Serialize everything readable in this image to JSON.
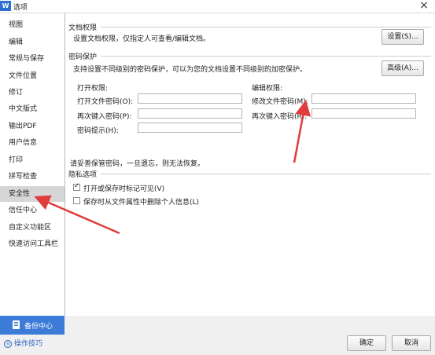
{
  "window": {
    "app_icon": "W",
    "title": "选项",
    "close": "×"
  },
  "sidebar": {
    "items": [
      {
        "label": "视图"
      },
      {
        "label": "编辑"
      },
      {
        "label": "常规与保存"
      },
      {
        "label": "文件位置"
      },
      {
        "label": "修订"
      },
      {
        "label": "中文版式"
      },
      {
        "label": "输出PDF"
      },
      {
        "label": "用户信息"
      },
      {
        "label": "打印"
      },
      {
        "label": "拼写检查"
      },
      {
        "label": "安全性"
      },
      {
        "label": "信任中心"
      },
      {
        "label": "自定义功能区"
      },
      {
        "label": "快速访问工具栏"
      }
    ],
    "active_item": "安全性",
    "backup_label": "备份中心",
    "tips_label": "操作技巧"
  },
  "doc_permission": {
    "title": "文档权限",
    "description": "设置文档权限，仅指定人可查看/编辑文档。",
    "settings_button": "设置(S)..."
  },
  "password": {
    "title": "密码保护",
    "description": "支持设置不同级别的密码保护，可以为您的文档设置不同级别的加密保护。",
    "advanced_button": "高级(A)...",
    "open_perm_title": "打开权限:",
    "open_password_label": "打开文件密码(O):",
    "open_confirm_label": "再次键入密码(P):",
    "hint_label": "密码提示(H):",
    "edit_perm_title": "编辑权限:",
    "modify_password_label": "修改文件密码(M):",
    "modify_confirm_label": "再次键入密码(R):",
    "open_password_value": "",
    "open_confirm_value": "",
    "hint_value": "",
    "modify_password_value": "",
    "modify_confirm_value": "",
    "notice": "请妥善保管密码，一旦遗忘，则无法恢复。"
  },
  "privacy": {
    "title": "隐私选项",
    "options": [
      {
        "label": "打开或保存时标记可见(V)",
        "checked": true
      },
      {
        "label": "保存时从文件属性中删除个人信息(L)",
        "checked": false
      }
    ]
  },
  "footer": {
    "ok": "确定",
    "cancel": "取消"
  },
  "colors": {
    "accent": "#3d7bd8",
    "arrow": "#e03c3c",
    "active_item_bg": "#d6d6d6"
  }
}
